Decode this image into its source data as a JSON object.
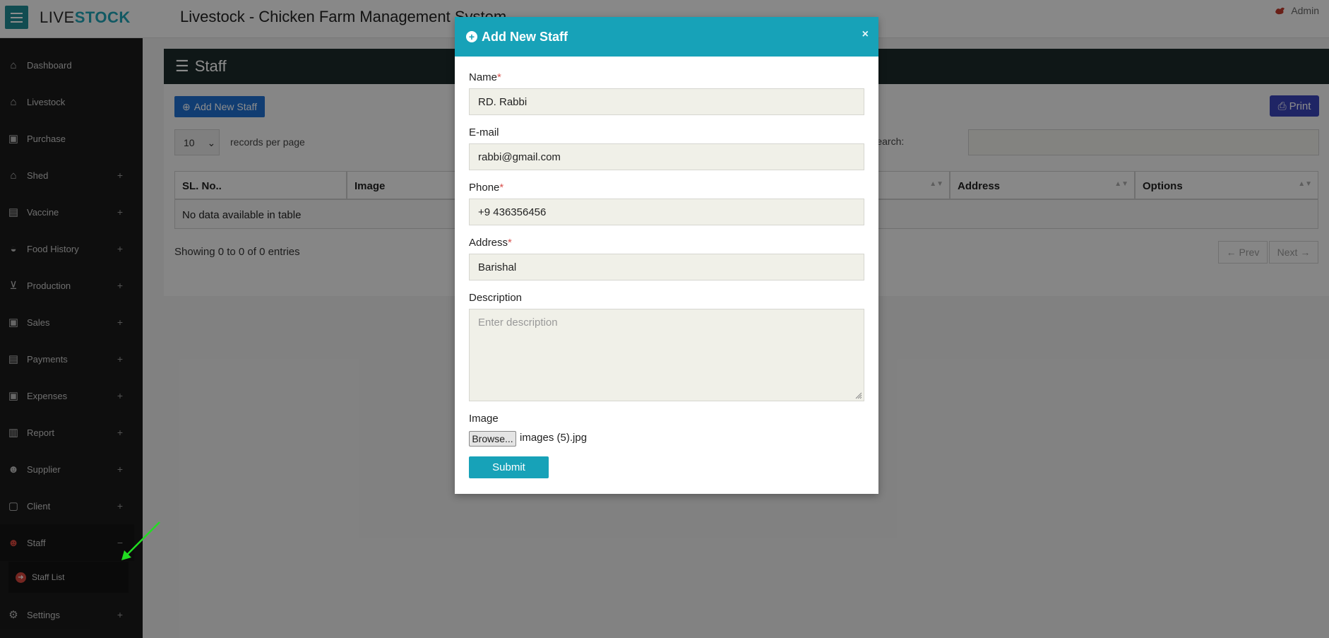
{
  "header": {
    "logo_part1": "LIVE",
    "logo_part2": "STOCK",
    "app_title": "Livestock - Chicken Farm Management System",
    "user_label": "Admin"
  },
  "sidebar": {
    "items": [
      {
        "label": "Dashboard",
        "icon": "home-icon"
      },
      {
        "label": "Livestock",
        "icon": "barn-icon"
      },
      {
        "label": "Purchase",
        "icon": "money-icon"
      },
      {
        "label": "Shed",
        "icon": "home-icon",
        "expand": "+"
      },
      {
        "label": "Vaccine",
        "icon": "medkit-icon",
        "expand": "+"
      },
      {
        "label": "Food History",
        "icon": "bowl-icon",
        "expand": "+"
      },
      {
        "label": "Production",
        "icon": "cart-icon",
        "expand": "+"
      },
      {
        "label": "Sales",
        "icon": "money-icon",
        "expand": "+"
      },
      {
        "label": "Payments",
        "icon": "briefcase-icon",
        "expand": "+"
      },
      {
        "label": "Expenses",
        "icon": "money-icon",
        "expand": "+"
      },
      {
        "label": "Report",
        "icon": "chart-icon",
        "expand": "+"
      },
      {
        "label": "Supplier",
        "icon": "users-icon",
        "expand": "+"
      },
      {
        "label": "Client",
        "icon": "user-frame-icon",
        "expand": "+"
      },
      {
        "label": "Staff",
        "icon": "staff-icon",
        "expand": "−"
      },
      {
        "label": "Settings",
        "icon": "gear-icon",
        "expand": "+"
      }
    ],
    "sub_item": "Staff List"
  },
  "page": {
    "title": "Staff",
    "add_button": "Add New Staff",
    "print_button": "Print",
    "per_page_value": "10",
    "per_page_label": "records per page",
    "search_label": "Search:",
    "columns": [
      "SL. No..",
      "Image",
      "Address",
      "Options"
    ],
    "empty_message": "No data available in table",
    "showing": "Showing 0 to 0 of 0 entries",
    "prev": "← Prev",
    "next": "Next →"
  },
  "modal": {
    "title": "Add New Staff",
    "close": "×",
    "fields": {
      "name_label": "Name",
      "name_value": "RD. Rabbi",
      "email_label": "E-mail",
      "email_value": "rabbi@gmail.com",
      "phone_label": "Phone",
      "phone_value": "+9 436356456",
      "address_label": "Address",
      "address_value": "Barishal",
      "description_label": "Description",
      "description_placeholder": "Enter description",
      "image_label": "Image",
      "browse_label": "Browse...",
      "file_name": "images (5).jpg"
    },
    "required_mark": "*",
    "submit": "Submit"
  },
  "colors": {
    "accent": "#17a2b8",
    "sidebar": "#1b1b1b",
    "add_button": "#1f6fcf",
    "print_button": "#3a44b8",
    "annotation_arrow": "#22dd22"
  }
}
